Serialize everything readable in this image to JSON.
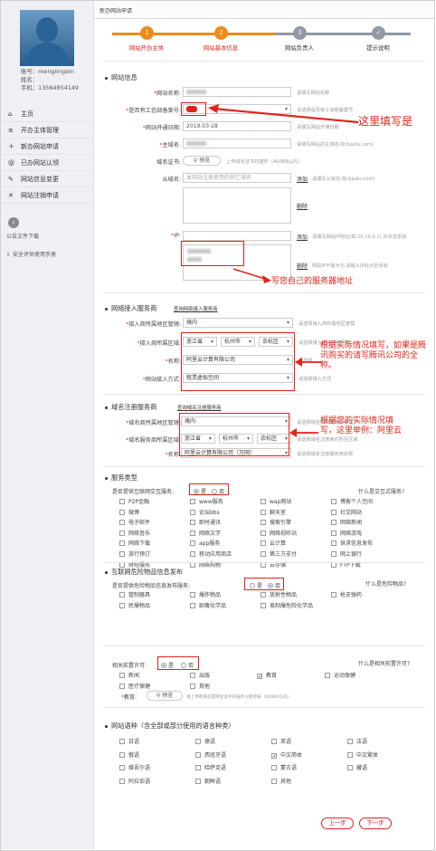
{
  "user": {
    "account": "账号：menglingbin",
    "name": "姓名：",
    "phone": "手机：13564854149"
  },
  "sidebar": {
    "items": [
      {
        "icon": "home-icon",
        "glyph": "⌂",
        "label": "主页"
      },
      {
        "icon": "list-icon",
        "glyph": "≡",
        "label": "开办主体管理"
      },
      {
        "icon": "plus-icon",
        "glyph": "＋",
        "label": "新办网站申请"
      },
      {
        "icon": "at-icon",
        "glyph": "@",
        "label": "已办网站认领"
      },
      {
        "icon": "edit-icon",
        "glyph": "✎",
        "label": "网站信息变更"
      },
      {
        "icon": "close-icon",
        "glyph": "✕",
        "label": "网站注销申请"
      }
    ],
    "notice_title": "公告文件下载",
    "notice_item": "安全评估使用手册"
  },
  "header": {
    "title": "新办网站申请"
  },
  "steps": [
    {
      "num": "1",
      "label": "网站开办主体",
      "color": "#f08a1c"
    },
    {
      "num": "2",
      "label": "网站基本信息",
      "color": "#f08a1c"
    },
    {
      "num": "3",
      "label": "网站负责人",
      "color": "#8f9aa5"
    },
    {
      "num": "✓",
      "label": "提示说明",
      "color": "#8f9aa5"
    }
  ],
  "site_info": {
    "section_title": "网站信息",
    "name_label": "网站名称:",
    "name_hint": "请填写网站名称",
    "icp_label": "是否有工信部备案号:",
    "icp_hint": "请选择是否有工信部备案号",
    "open_date_label": "网站开通日期:",
    "open_date_value": "2019-03-28",
    "open_date_hint": "请填写网站开通日期",
    "domain_label": "主域名:",
    "domain_hint": "请填写网站的主域名(如:baidu.com)",
    "cert_label": "域名证书:",
    "cert_button": "预览",
    "cert_hint": "上传域名证书扫描件（400KB以内）",
    "sub_label": "从域名:",
    "sub_placeholder": "本网站注册使用的其它域名",
    "sub_add": "添加",
    "sub_hint": "请填写从域名(如:baidu.com)",
    "sub_del": "删除",
    "ip_label": "IP:",
    "ip_add": "添加",
    "ip_hint": "请填写网站IP地址(如:20.10.0.1),并点击添加",
    "ip_del": "删除",
    "ip_hint2": "网站IP不能为空,请输入IP后点击添加"
  },
  "access": {
    "section_title": "网络接入服务商",
    "link": "查询网络接入服务商",
    "region_label": "接入商所属地区管辖:",
    "region_value": "境内",
    "region_hint": "请选择接入商所属地区管辖",
    "area_label": "接入商所属区域:",
    "province": "浙江省",
    "city": "杭州市",
    "district": "余杭区",
    "area_hint": "请选择接入商的所在区域",
    "name_label": "名称:",
    "name_value": "阿里云计算有限公司",
    "name_hint": "请选择",
    "mode_label": "网站接入方式:",
    "mode_value": "租赁虚拟空间",
    "mode_hint": "请选择接入方式"
  },
  "registrar": {
    "section_title": "域名注册服务商",
    "link": "查询域名注册服务商",
    "region_label": "域名商所属地区管辖:",
    "region_value": "境内",
    "region_hint": "请选择域名商所属地区管辖",
    "area_label": "域名服务商所属区域:",
    "province": "浙江省",
    "city": "杭州市",
    "district": "余杭区",
    "area_hint": "请选择域名注册商的所在区域",
    "name_label": "名称:",
    "name_value": "阿里云计算有限公司（万网）",
    "name_hint": "请选择域名注册服务商名称"
  },
  "service": {
    "section_title": "服务类型",
    "question": "是否提供互联网交互服务:",
    "yes": "是",
    "no": "否",
    "what": "什么是交互式服务?",
    "items": [
      "P2P金融",
      "www服务",
      "wap网站",
      "博客个人空间",
      "微博",
      "论坛bbs",
      "聊天室",
      "社交网站",
      "电子邮件",
      "即时通讯",
      "搜索引擎",
      "网络新闻",
      "网络音乐",
      "网络文学",
      "网络视听站",
      "网络游戏",
      "网络下载",
      "app服务",
      "云计算",
      "供求信息发布",
      "旅行预订",
      "移动应用商店",
      "第三方支付",
      "网上银行",
      "财经服务",
      "网络购物",
      "云存储",
      "FTP下载"
    ]
  },
  "danger": {
    "section_title": "互联网危险物品信息发布",
    "question": "是否提供危险物品信息发布服务:",
    "yes": "是",
    "no": "否",
    "what": "什么是危险物品?",
    "items": [
      "管制器具",
      "爆炸物品",
      "放射性物品",
      "枪支弹药",
      "民爆物品",
      "剧毒化学品",
      "易制爆危险化学品"
    ]
  },
  "permit": {
    "question": "相关前置许可:",
    "yes": "是",
    "no": "否",
    "what": "什么是相关前置许可?",
    "items": [
      "新闻",
      "出版",
      "教育",
      "医疗保健",
      "其他",
      "运动保健"
    ],
    "edu_label": "教育:",
    "edu_button": "预览",
    "edu_hint": "请上传教育前置审批证件扫描件以便审核（400KB以内）"
  },
  "language": {
    "section_title": "网站语种（含全部或部分使用的语言种类）",
    "items": [
      "日语",
      "德语",
      "英语",
      "法语",
      "俄语",
      "西班牙语",
      "中文简体",
      "中文繁体",
      "维吾尔语",
      "哈萨克语",
      "蒙古语",
      "藏语",
      "阿拉伯语",
      "朝鲜语",
      "其他"
    ],
    "checked": "中文简体"
  },
  "buttons": {
    "prev": "上一步",
    "next": "下一步"
  },
  "annotations": {
    "icp": "这里填写是",
    "ip": "写您自己的服务器地址",
    "access": "根据实际情况填写，如果是腾讯购买的请写腾讯公司的全称。",
    "registrar": "根据您的实际情况填写，这里举例：阿里云"
  }
}
